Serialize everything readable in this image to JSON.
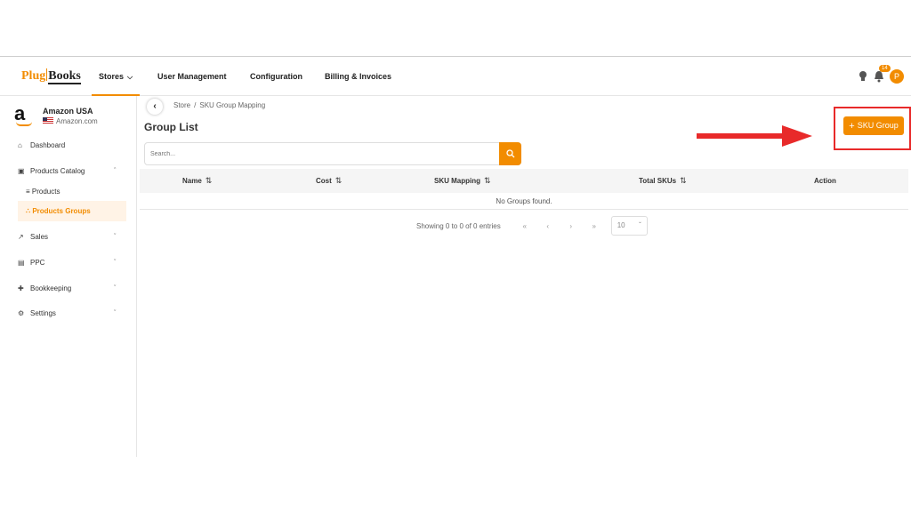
{
  "app": {
    "logo_plug": "Plug",
    "logo_books": "Books"
  },
  "topnav": {
    "items": [
      {
        "label": "Stores"
      },
      {
        "label": "User Management"
      },
      {
        "label": "Configuration"
      },
      {
        "label": "Billing & Invoices"
      }
    ],
    "notification_count": "14",
    "avatar_initial": "P"
  },
  "sidebar": {
    "store_name": "Amazon USA",
    "store_domain": "Amazon.com",
    "items": [
      {
        "label": "Dashboard",
        "icon": "home-icon"
      },
      {
        "label": "Products Catalog",
        "icon": "catalog-icon"
      },
      {
        "label": "Products",
        "icon": "list-icon"
      },
      {
        "label": "Products Groups",
        "icon": "group-icon"
      },
      {
        "label": "Sales",
        "icon": "chart-icon"
      },
      {
        "label": "PPC",
        "icon": "ppc-icon"
      },
      {
        "label": "Bookkeeping",
        "icon": "bookkeeping-icon"
      },
      {
        "label": "Settings",
        "icon": "gear-icon"
      }
    ]
  },
  "main": {
    "breadcrumb": [
      "Store",
      "SKU Group Mapping"
    ],
    "title": "Group List",
    "search_placeholder": "Search...",
    "add_button_label": "SKU Group",
    "table": {
      "columns": [
        "Name",
        "Cost",
        "SKU Mapping",
        "Total SKUs",
        "Action"
      ],
      "empty_message": "No Groups found."
    },
    "pager": {
      "info": "Showing 0 to 0 of 0 entries",
      "page_size": "10"
    }
  },
  "colors": {
    "accent": "#f28c00",
    "highlight": "#e82a2a"
  }
}
